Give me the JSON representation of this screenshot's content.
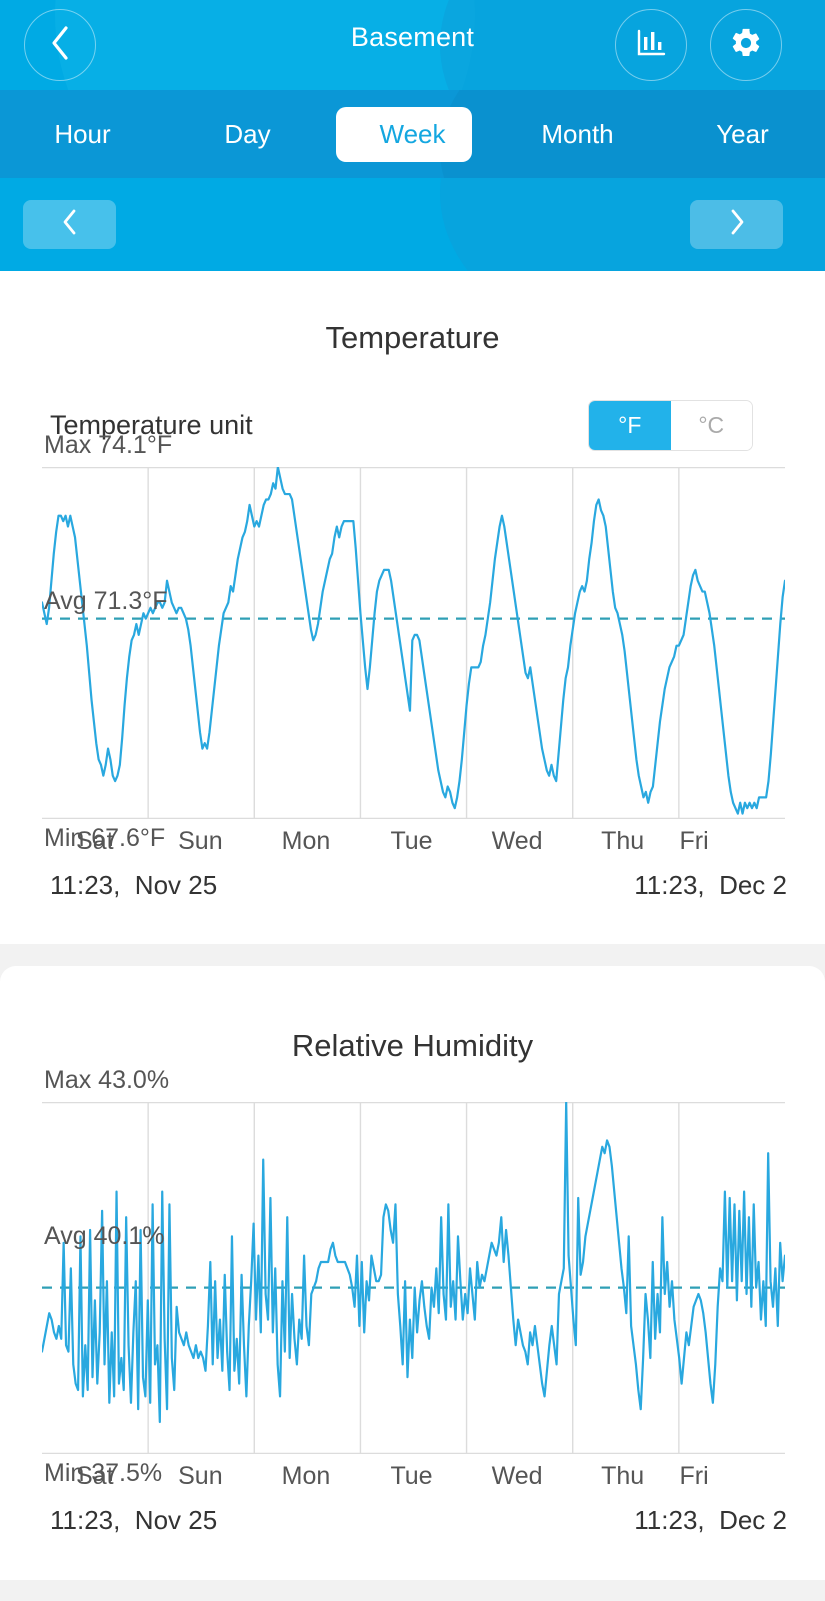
{
  "theme": {
    "header_blue": "#00aae4",
    "tabbar_blue": "#0b97d6",
    "accent": "#22b2ea",
    "line_color": "#29a8df",
    "avg_line_color": "#2f9fb5",
    "grid_color": "#dcdcdc",
    "text_dark": "#333333",
    "text_muted": "#555555"
  },
  "header": {
    "title": "Basement",
    "back_icon": "chevron-left-icon",
    "chart_icon": "bar-chart-icon",
    "settings_icon": "gear-icon"
  },
  "tabs": {
    "items": [
      {
        "label": "Hour",
        "active": false
      },
      {
        "label": "Day",
        "active": false
      },
      {
        "label": "Week",
        "active": true
      },
      {
        "label": "Month",
        "active": false
      },
      {
        "label": "Year",
        "active": false
      }
    ],
    "selected": "Week"
  },
  "nav": {
    "prev_icon": "chevron-left-icon",
    "next_icon": "chevron-right-icon"
  },
  "temperature": {
    "title": "Temperature",
    "unit_label": "Temperature unit",
    "unit_options": [
      "°F",
      "°C"
    ],
    "unit_selected": "°F",
    "max_label": "Max 74.1°F",
    "avg_label": "Avg 71.3°F",
    "min_label": "Min 67.6°F",
    "range_start": "11:23,  Nov 25",
    "range_end": "11:23,  Dec 2",
    "days": [
      "Sat",
      "Sun",
      "Mon",
      "Tue",
      "Wed",
      "Thu",
      "Fri"
    ]
  },
  "humidity": {
    "title": "Relative Humidity",
    "max_label": "Max 43.0%",
    "avg_label": "Avg 40.1%",
    "min_label": "Min 37.5%",
    "range_start": "11:23,  Nov 25",
    "range_end": "11:23,  Dec 2",
    "days": [
      "Sat",
      "Sun",
      "Mon",
      "Tue",
      "Wed",
      "Thu",
      "Fri"
    ]
  },
  "chart_data": [
    {
      "id": "temperature",
      "type": "line",
      "title": "Temperature",
      "xlabel": "",
      "ylabel": "°F",
      "ylim": [
        67.6,
        74.1
      ],
      "grid": true,
      "legend": "none",
      "categories": [
        "Sat",
        "Sun",
        "Mon",
        "Tue",
        "Wed",
        "Thu",
        "Fri"
      ],
      "x_range": [
        "11:23, Nov 25",
        "11:23, Dec 2"
      ],
      "max": 74.1,
      "min": 67.6,
      "avg": 71.3,
      "avg_line": true,
      "series": [
        {
          "name": "Temperature",
          "color": "#29a8df",
          "values": [
            71.6,
            71.4,
            71.2,
            71.5,
            72.0,
            72.5,
            72.9,
            73.2,
            73.2,
            73.1,
            73.2,
            73.0,
            73.2,
            73.0,
            72.8,
            72.4,
            72.0,
            71.6,
            71.2,
            70.8,
            70.3,
            69.8,
            69.4,
            69.0,
            68.7,
            68.6,
            68.4,
            68.6,
            68.9,
            68.7,
            68.4,
            68.3,
            68.4,
            68.6,
            69.1,
            69.7,
            70.2,
            70.6,
            70.9,
            71.0,
            71.2,
            71.0,
            71.2,
            71.4,
            71.3,
            71.4,
            71.5,
            71.4,
            71.5,
            71.6,
            71.6,
            71.5,
            71.6,
            72.0,
            71.8,
            71.6,
            71.5,
            71.4,
            71.5,
            71.5,
            71.4,
            71.3,
            71.1,
            70.8,
            70.4,
            70.0,
            69.6,
            69.2,
            68.9,
            69.0,
            68.9,
            69.2,
            69.6,
            70.0,
            70.4,
            70.8,
            71.1,
            71.4,
            71.5,
            71.6,
            71.9,
            71.8,
            72.1,
            72.4,
            72.6,
            72.8,
            72.9,
            73.1,
            73.4,
            73.2,
            73.0,
            73.1,
            73.0,
            73.2,
            73.4,
            73.5,
            73.5,
            73.6,
            73.8,
            73.7,
            74.1,
            73.9,
            73.7,
            73.6,
            73.6,
            73.6,
            73.5,
            73.2,
            72.9,
            72.6,
            72.3,
            72.0,
            71.7,
            71.4,
            71.1,
            70.9,
            71.0,
            71.2,
            71.5,
            71.8,
            72.0,
            72.2,
            72.4,
            72.5,
            72.8,
            73.0,
            72.8,
            73.0,
            73.1,
            73.1,
            73.1,
            73.1,
            73.1,
            72.6,
            72.0,
            71.4,
            70.9,
            70.4,
            70.0,
            70.4,
            70.9,
            71.4,
            71.8,
            72.0,
            72.1,
            72.2,
            72.2,
            72.2,
            72.0,
            71.7,
            71.4,
            71.1,
            70.8,
            70.5,
            70.2,
            69.9,
            69.6,
            70.9,
            71.0,
            71.0,
            70.9,
            70.6,
            70.3,
            70.0,
            69.7,
            69.4,
            69.1,
            68.8,
            68.5,
            68.3,
            68.1,
            68.0,
            68.2,
            68.1,
            67.9,
            67.8,
            68.0,
            68.3,
            68.7,
            69.2,
            69.7,
            70.1,
            70.4,
            70.4,
            70.4,
            70.4,
            70.5,
            70.8,
            71.0,
            71.3,
            71.6,
            72.0,
            72.4,
            72.7,
            73.0,
            73.2,
            73.0,
            72.7,
            72.4,
            72.1,
            71.8,
            71.5,
            71.2,
            70.9,
            70.6,
            70.3,
            70.2,
            70.4,
            70.1,
            69.8,
            69.5,
            69.2,
            68.9,
            68.7,
            68.5,
            68.4,
            68.6,
            68.4,
            68.3,
            68.8,
            69.3,
            69.8,
            70.2,
            70.4,
            70.8,
            71.1,
            71.4,
            71.6,
            71.8,
            71.9,
            71.8,
            72.0,
            72.4,
            72.7,
            73.1,
            73.4,
            73.5,
            73.3,
            73.2,
            73.0,
            72.6,
            72.2,
            71.8,
            71.5,
            71.4,
            71.2,
            71.0,
            70.7,
            70.3,
            69.9,
            69.5,
            69.1,
            68.7,
            68.4,
            68.2,
            68.0,
            68.1,
            67.9,
            68.1,
            68.2,
            68.6,
            69.0,
            69.4,
            69.7,
            70.0,
            70.2,
            70.4,
            70.5,
            70.6,
            70.8,
            70.8,
            70.9,
            71.0,
            71.3,
            71.6,
            71.9,
            72.1,
            72.2,
            72.0,
            71.9,
            71.8,
            71.8,
            71.6,
            71.4,
            71.1,
            70.8,
            70.4,
            70.0,
            69.6,
            69.2,
            68.8,
            68.4,
            68.1,
            67.9,
            67.8,
            67.7,
            67.9,
            67.7,
            67.9,
            67.8,
            67.9,
            67.8,
            67.9,
            67.8,
            68.0,
            68.0,
            68.0,
            68.0,
            68.3,
            68.8,
            69.4,
            70.0,
            70.6,
            71.2,
            71.7,
            72.0
          ]
        }
      ]
    },
    {
      "id": "relative-humidity",
      "type": "line",
      "title": "Relative Humidity",
      "xlabel": "",
      "ylabel": "%",
      "ylim": [
        37.5,
        43.0
      ],
      "grid": true,
      "legend": "none",
      "categories": [
        "Sat",
        "Sun",
        "Mon",
        "Tue",
        "Wed",
        "Thu",
        "Fri"
      ],
      "x_range": [
        "11:23, Nov 25",
        "11:23, Dec 2"
      ],
      "max": 43.0,
      "min": 37.5,
      "avg": 40.1,
      "avg_line": true,
      "series": [
        {
          "name": "Relative Humidity",
          "color": "#29a8df",
          "values": [
            39.1,
            39.3,
            39.5,
            39.7,
            39.6,
            39.4,
            39.3,
            39.5,
            39.3,
            40.8,
            39.2,
            39.1,
            40.4,
            38.9,
            38.6,
            38.5,
            40.9,
            38.4,
            39.2,
            38.5,
            41.0,
            38.7,
            39.9,
            38.6,
            39.4,
            41.3,
            38.9,
            40.2,
            38.3,
            39.4,
            38.4,
            41.6,
            38.6,
            39.0,
            38.5,
            41.2,
            39.2,
            38.3,
            39.4,
            40.2,
            38.2,
            41.0,
            38.7,
            38.4,
            39.9,
            38.3,
            41.4,
            38.9,
            39.2,
            38.0,
            41.6,
            39.3,
            38.2,
            41.4,
            39.0,
            38.5,
            39.8,
            39.4,
            39.3,
            39.2,
            39.4,
            39.2,
            39.1,
            39.0,
            39.2,
            39.0,
            39.1,
            39.0,
            38.8,
            39.5,
            40.5,
            38.9,
            40.2,
            39.0,
            39.6,
            38.8,
            40.3,
            39.1,
            38.5,
            40.9,
            38.8,
            39.3,
            38.6,
            40.3,
            39.2,
            38.4,
            39.5,
            40.2,
            41.1,
            39.6,
            40.6,
            39.4,
            42.1,
            40.0,
            39.6,
            41.5,
            39.4,
            40.4,
            38.9,
            38.4,
            40.2,
            39.1,
            41.2,
            39.0,
            40.0,
            39.3,
            38.9,
            39.6,
            39.3,
            40.6,
            39.5,
            39.2,
            40.0,
            40.1,
            40.2,
            40.4,
            40.5,
            40.5,
            40.5,
            40.5,
            40.7,
            40.8,
            40.6,
            40.5,
            40.5,
            40.5,
            40.5,
            40.4,
            40.3,
            40.1,
            39.8,
            40.6,
            39.5,
            40.5,
            39.4,
            40.2,
            39.9,
            40.6,
            40.4,
            40.2,
            40.2,
            40.3,
            41.2,
            41.4,
            41.3,
            41.0,
            40.8,
            41.4,
            40.0,
            39.5,
            38.9,
            40.2,
            38.7,
            39.6,
            39.0,
            40.1,
            39.4,
            39.9,
            40.2,
            39.8,
            39.5,
            39.3,
            40.1,
            39.8,
            40.4,
            39.7,
            41.2,
            40.0,
            39.6,
            41.4,
            39.8,
            40.2,
            39.6,
            40.9,
            40.2,
            39.6,
            40.0,
            39.7,
            40.4,
            40.0,
            39.6,
            40.5,
            40.1,
            40.3,
            40.2,
            40.4,
            40.6,
            40.8,
            40.7,
            40.6,
            40.8,
            41.2,
            40.5,
            41.0,
            40.6,
            40.1,
            39.6,
            39.2,
            39.6,
            39.4,
            39.2,
            39.1,
            38.9,
            39.4,
            39.2,
            39.5,
            39.2,
            38.9,
            38.6,
            38.4,
            38.8,
            39.2,
            39.5,
            39.2,
            38.9,
            40.0,
            40.2,
            40.4,
            43.0,
            40.6,
            40.1,
            39.6,
            39.2,
            41.5,
            40.3,
            40.5,
            40.9,
            41.1,
            41.3,
            41.5,
            41.7,
            41.9,
            42.1,
            42.3,
            42.2,
            42.4,
            42.3,
            42.0,
            41.6,
            41.2,
            40.8,
            40.4,
            40.1,
            39.7,
            40.9,
            39.5,
            39.2,
            38.9,
            38.5,
            38.2,
            39.0,
            40.0,
            39.6,
            39.0,
            40.5,
            39.3,
            40.0,
            39.4,
            41.2,
            40.0,
            40.5,
            39.8,
            40.2,
            39.6,
            39.3,
            39.0,
            38.6,
            39.0,
            39.4,
            39.2,
            39.5,
            39.8,
            39.9,
            40.0,
            39.9,
            39.7,
            39.4,
            39.0,
            38.6,
            38.3,
            38.9,
            39.8,
            40.4,
            40.2,
            41.6,
            40.1,
            41.5,
            40.2,
            41.4,
            39.9,
            41.3,
            40.2,
            41.6,
            40.0,
            41.2,
            39.8,
            41.4,
            40.1,
            40.5,
            39.6,
            40.2,
            39.5,
            42.2,
            40.2,
            39.8,
            40.4,
            39.5,
            40.8,
            40.2,
            40.6
          ]
        }
      ]
    }
  ]
}
